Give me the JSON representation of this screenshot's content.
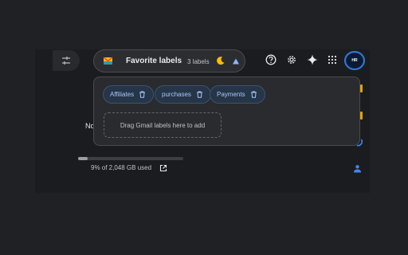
{
  "header": {
    "title": "Favorite labels",
    "label_count": "3 labels"
  },
  "labels": [
    {
      "name": "Affiliates"
    },
    {
      "name": "purchases"
    },
    {
      "name": "Payments"
    }
  ],
  "drop_zone": "Drag Gmail labels here to add",
  "background": {
    "truncated_text": "No",
    "storage_text": "9% of 2,048 GB used",
    "storage_percent": 9
  },
  "account": {
    "avatar_initials": "HR"
  },
  "colors": {
    "accent": "#a8c7fa",
    "chip_bg": "#263547",
    "panel_bg": "#2a2b2e",
    "avatar_ring": "#2f7bde",
    "triangle": "#8ab4f8",
    "moon": "#fbbc04"
  },
  "icons": {
    "filter": "tune-icon",
    "extension": "envelope-icon",
    "theme": "moon-icon",
    "collapse": "triangle-up-icon",
    "help": "help-icon",
    "settings": "gear-icon",
    "gemini": "sparkle-icon",
    "apps": "apps-grid-icon",
    "delete": "trash-icon",
    "open": "open-in-new-icon"
  }
}
